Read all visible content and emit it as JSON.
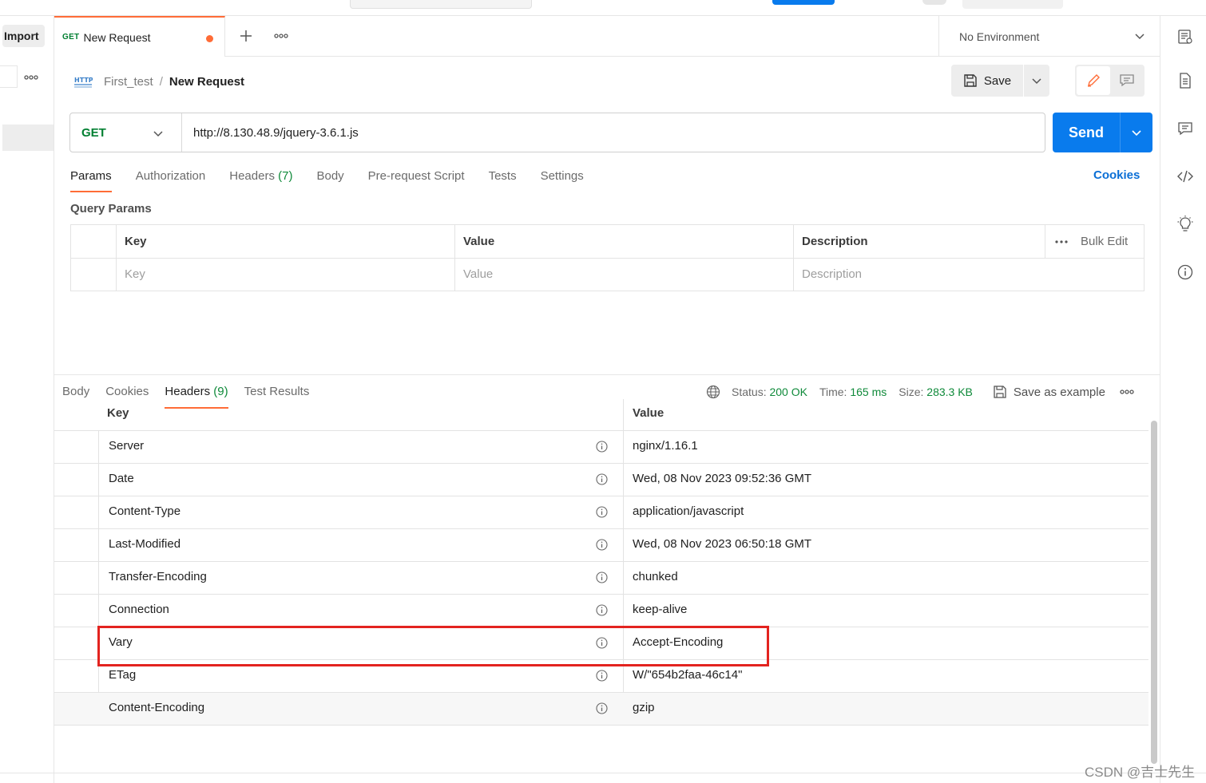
{
  "sidebar": {
    "import_label": "Import"
  },
  "tab": {
    "method": "GET",
    "name": "New Request"
  },
  "environment": {
    "label": "No Environment"
  },
  "breadcrumb": {
    "parent": "First_test",
    "separator": "/",
    "current": "New Request"
  },
  "toolbar": {
    "save_label": "Save"
  },
  "request": {
    "method": "GET",
    "url": "http://8.130.48.9/jquery-3.6.1.js",
    "send_label": "Send",
    "tabs": [
      {
        "label": "Params"
      },
      {
        "label": "Authorization"
      },
      {
        "label": "Headers",
        "count": "(7)"
      },
      {
        "label": "Body"
      },
      {
        "label": "Pre-request Script"
      },
      {
        "label": "Tests"
      },
      {
        "label": "Settings"
      }
    ],
    "cookies_label": "Cookies"
  },
  "query_params": {
    "title": "Query Params",
    "columns": {
      "key": "Key",
      "value": "Value",
      "description": "Description"
    },
    "placeholders": {
      "key": "Key",
      "value": "Value",
      "description": "Description"
    },
    "bulk_edit_label": "Bulk Edit"
  },
  "response": {
    "tabs": [
      {
        "label": "Body"
      },
      {
        "label": "Cookies"
      },
      {
        "label": "Headers",
        "count": "(9)"
      },
      {
        "label": "Test Results"
      }
    ],
    "status_label": "Status:",
    "status_value": "200 OK",
    "time_label": "Time:",
    "time_value": "165 ms",
    "size_label": "Size:",
    "size_value": "283.3 KB",
    "save_example_label": "Save as example",
    "headers_columns": {
      "key": "Key",
      "value": "Value"
    },
    "headers": [
      {
        "key": "Server",
        "value": "nginx/1.16.1"
      },
      {
        "key": "Date",
        "value": "Wed, 08 Nov 2023 09:52:36 GMT"
      },
      {
        "key": "Content-Type",
        "value": "application/javascript"
      },
      {
        "key": "Last-Modified",
        "value": "Wed, 08 Nov 2023 06:50:18 GMT"
      },
      {
        "key": "Transfer-Encoding",
        "value": "chunked"
      },
      {
        "key": "Connection",
        "value": "keep-alive"
      },
      {
        "key": "Vary",
        "value": "Accept-Encoding"
      },
      {
        "key": "ETag",
        "value": "W/\"654b2faa-46c14\""
      },
      {
        "key": "Content-Encoding",
        "value": "gzip"
      }
    ]
  },
  "watermark": "CSDN @吉士先生",
  "colors": {
    "accent": "#ff6c37",
    "send": "#097bed",
    "method_get": "#007f31",
    "status_ok": "#0f8a3a",
    "highlight": "#e3231f"
  }
}
